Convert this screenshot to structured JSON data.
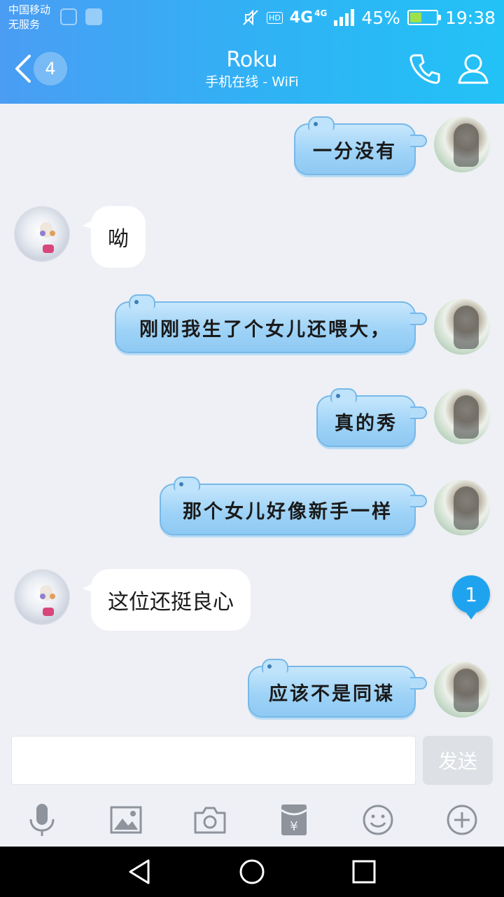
{
  "status_bar": {
    "carrier_line1": "中国移动",
    "carrier_line2": "无服务",
    "hd": "HD",
    "network": "4G",
    "network_small": "4G",
    "battery": "45%",
    "time": "19:38",
    "battery_level": 0.45
  },
  "header": {
    "unread_count": "4",
    "title": "Roku",
    "subtitle": "手机在线 - WiFi"
  },
  "messages": [
    {
      "sender": "me",
      "text": "一分没有"
    },
    {
      "sender": "them",
      "text": "呦"
    },
    {
      "sender": "me",
      "text": "刚刚我生了个女儿还喂大，"
    },
    {
      "sender": "me",
      "text": "真的秀"
    },
    {
      "sender": "me",
      "text": "那个女儿好像新手一样"
    },
    {
      "sender": "them",
      "text": "这位还挺良心"
    },
    {
      "sender": "me",
      "text": "应该不是同谋"
    }
  ],
  "new_message_badge": "1",
  "input": {
    "value": "",
    "placeholder": "",
    "send_label": "发送"
  },
  "toolbar_icons": [
    "microphone-icon",
    "image-icon",
    "camera-icon",
    "red-packet-icon",
    "emoji-icon",
    "plus-icon"
  ],
  "colors": {
    "header_start": "#4a9df3",
    "header_end": "#22c2f6",
    "bubble_me": "#9fd3f7",
    "bubble_them": "#ffffff",
    "badge": "#1fa3ef"
  }
}
